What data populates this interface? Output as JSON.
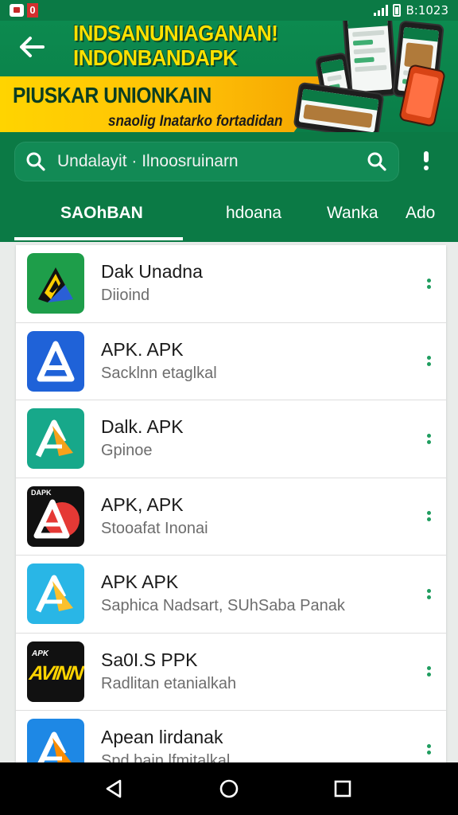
{
  "status_bar": {
    "notification_badge": "0",
    "time": "B:1023"
  },
  "banner": {
    "title_line1": "INDSANUNIAGANAN!",
    "title_line2": "INDONBANDAPK",
    "subtitle": "PIUSKAR UNIONKAIN",
    "caption": "snaolig Inatarko fortadidan"
  },
  "search": {
    "placeholder": "Undalayit · Ilnoosruinarn"
  },
  "tabs": [
    {
      "label": "SAOhBAN",
      "active": true
    },
    {
      "label": "hdoana",
      "active": false
    },
    {
      "label": "Wanka",
      "active": false
    },
    {
      "label": "Ado",
      "active": false
    }
  ],
  "apps": [
    {
      "name": "Dak Unadna",
      "subtitle": "Diioind",
      "icon": "drive-triangle-icon",
      "icon_colors": [
        "#1e9e4a",
        "#ffcf00",
        "#2a5fd6"
      ]
    },
    {
      "name": "APK. APK",
      "subtitle": "Sacklnn etaglkal",
      "icon": "apk-a-blue-icon",
      "icon_colors": [
        "#1f62d8"
      ]
    },
    {
      "name": "Dalk. APK",
      "subtitle": "Gpinoe",
      "icon": "apk-a-teal-icon",
      "icon_colors": [
        "#17a88a",
        "#f7a21b"
      ]
    },
    {
      "name": "APK, APK",
      "subtitle": "Stooafat Inonai",
      "icon": "apk-a-red-black-icon",
      "icon_colors": [
        "#111111",
        "#e53935"
      ],
      "icon_text": "DAPK"
    },
    {
      "name": "APK APK",
      "subtitle": "Saphica Nadsart, SUhSaba Panak",
      "icon": "apk-a-cyan-icon",
      "icon_colors": [
        "#29b6e6",
        "#fbc02d"
      ]
    },
    {
      "name": "Sa0I.S PPK",
      "subtitle": "Radlitan etanialkah",
      "icon": "apk-text-yellow-icon",
      "icon_colors": [
        "#111111",
        "#ffd400"
      ],
      "icon_text": "AVINN",
      "icon_small": "APK"
    },
    {
      "name": "Apean lirdanak",
      "subtitle": "Spd bain lfmitalkal",
      "icon": "apk-a-blue-orange-icon",
      "icon_colors": [
        "#1e88e5",
        "#fb8c00"
      ]
    }
  ],
  "colors": {
    "brand_green": "#0b7a45",
    "accent_yellow": "#ffd400",
    "dot_green": "#1f9d5f"
  }
}
